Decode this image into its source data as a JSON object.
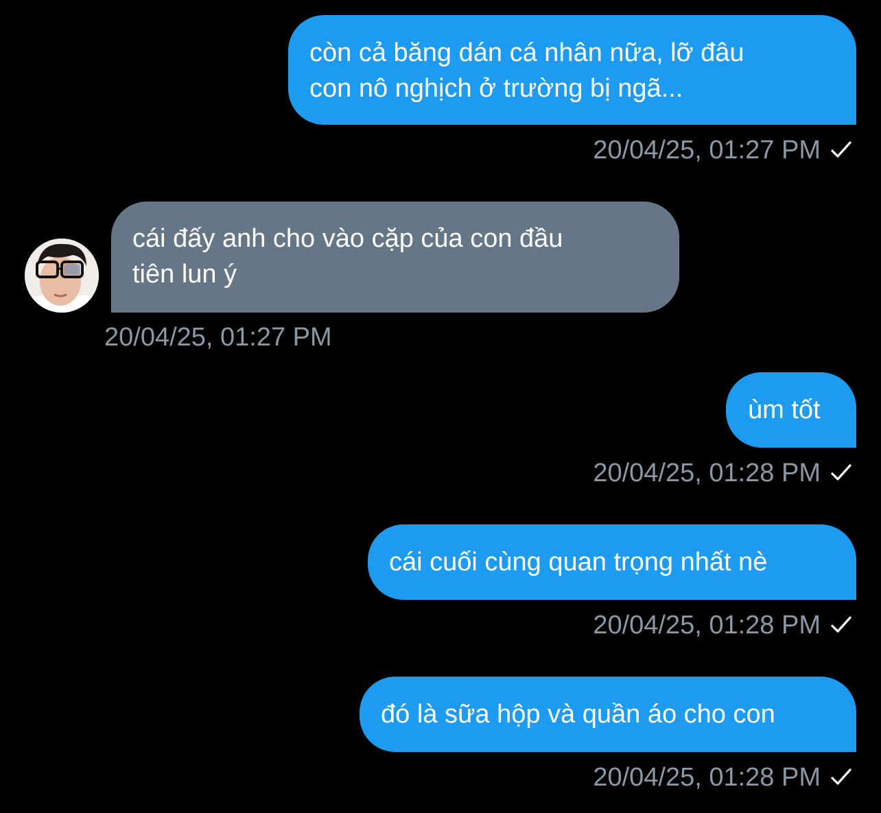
{
  "conversation": {
    "colors": {
      "background": "#000000",
      "sent_bubble": "#1d9bf0",
      "received_bubble": "#657786",
      "timestamp": "#8b98a5",
      "text": "#ffffff"
    },
    "messages": [
      {
        "direction": "sent",
        "text": "còn cả băng dán cá nhân nữa, lỡ đâu\ncon nô nghịch ở trường bị ngã...",
        "time": "20/04/25, 01:27 PM",
        "status_icon": "check-icon"
      },
      {
        "direction": "received",
        "text": "cái đấy anh cho vào cặp của con đầu\ntiên lun ý",
        "time": "20/04/25, 01:27 PM",
        "avatar_icon": "avatar"
      },
      {
        "direction": "sent",
        "text": "ùm tốt",
        "time": "20/04/25, 01:28 PM",
        "status_icon": "check-icon"
      },
      {
        "direction": "sent",
        "text": "cái cuối cùng quan trọng nhất nè",
        "time": "20/04/25, 01:28 PM",
        "status_icon": "check-icon"
      },
      {
        "direction": "sent",
        "text": "đó là sữa hộp và quần áo cho con",
        "time": "20/04/25, 01:28 PM",
        "status_icon": "check-icon"
      }
    ]
  }
}
